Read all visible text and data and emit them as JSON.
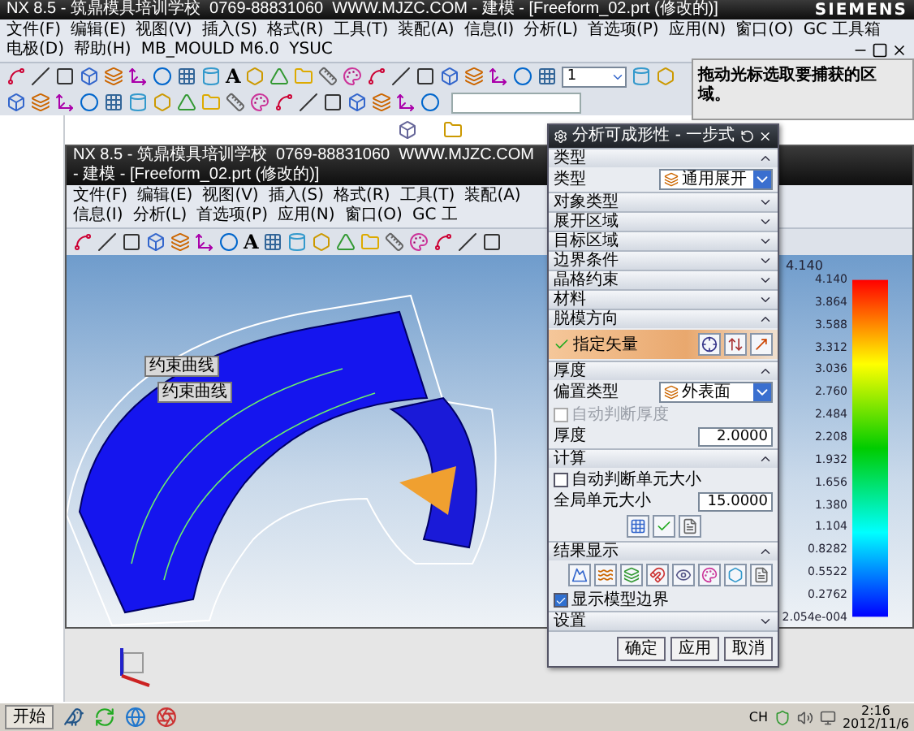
{
  "window": {
    "title": "NX 8.5 - 筑鼎模具培训学校  0769-88831060  WWW.MJZC.COM - 建模 - [Freeform_02.prt (修改的)]",
    "brand": "SIEMENS"
  },
  "menu": [
    "文件(F)",
    "编辑(E)",
    "视图(V)",
    "插入(S)",
    "格式(R)",
    "工具(T)",
    "装配(A)",
    "信息(I)",
    "分析(L)",
    "首选项(P)",
    "应用(N)",
    "窗口(O)",
    "GC 工具箱",
    "电极(D)",
    "帮助(H)",
    "MB_MOULD M6.0",
    "YSUC"
  ],
  "toolbar": {
    "text_tool": "A",
    "layer": "1"
  },
  "tooltip": "拖动光标选取要捕获的区域。",
  "inner_window": {
    "title": "NX 8.5 - 筑鼎模具培训学校  0769-88831060  WWW.MJZC.COM - 建模 - [Freeform_02.prt (修改的)]",
    "menu": [
      "文件(F)",
      "编辑(E)",
      "视图(V)",
      "插入(S)",
      "格式(R)",
      "工具(T)",
      "装配(A)",
      "信息(I)",
      "分析(L)",
      "首选项(P)",
      "应用(N)",
      "窗口(O)",
      "GC 工"
    ],
    "text_tool": "A"
  },
  "callouts": [
    "约束曲线",
    "约束曲线"
  ],
  "legend": {
    "title": "4.140",
    "values": [
      "4.140",
      "3.864",
      "3.588",
      "3.312",
      "3.036",
      "2.760",
      "2.484",
      "2.208",
      "1.932",
      "1.656",
      "1.380",
      "1.104",
      "0.8282",
      "0.5522",
      "0.2762",
      "2.054e-004"
    ]
  },
  "dialog": {
    "title": "分析可成形性 - 一步式",
    "sections": [
      {
        "label": "类型",
        "expanded": true,
        "rows": [
          {
            "kind": "select",
            "label": "类型",
            "value": "通用展开"
          }
        ]
      },
      {
        "label": "对象类型",
        "expanded": false
      },
      {
        "label": "展开区域",
        "expanded": false
      },
      {
        "label": "目标区域",
        "expanded": false
      },
      {
        "label": "边界条件",
        "expanded": false
      },
      {
        "label": "晶格约束",
        "expanded": false
      },
      {
        "label": "材料",
        "expanded": false
      },
      {
        "label": "脱模方向",
        "expanded": true,
        "rows": [
          {
            "kind": "vector",
            "label": "指定矢量"
          }
        ]
      },
      {
        "label": "厚度",
        "expanded": true,
        "rows": [
          {
            "kind": "select",
            "label": "偏置类型",
            "value": "外表面"
          },
          {
            "kind": "checkbox",
            "label": "自动判断厚度",
            "checked": false,
            "disabled": true
          },
          {
            "kind": "number",
            "label": "厚度",
            "value": "2.0000"
          }
        ]
      },
      {
        "label": "计算",
        "expanded": true,
        "rows": [
          {
            "kind": "checkbox",
            "label": "自动判断单元大小",
            "checked": false,
            "disabled": false
          },
          {
            "kind": "number",
            "label": "全局单元大小",
            "value": "15.0000"
          },
          {
            "kind": "compute_icons"
          }
        ]
      },
      {
        "label": "结果显示",
        "expanded": true,
        "rows": [
          {
            "kind": "result_icons"
          },
          {
            "kind": "checkbox",
            "label": "显示模型边界",
            "checked": true,
            "disabled": false
          }
        ]
      },
      {
        "label": "设置",
        "expanded": false
      }
    ],
    "buttons": [
      "确定",
      "应用",
      "取消"
    ]
  },
  "taskbar": {
    "start": "开始",
    "language": "CH",
    "time": "2:16",
    "date": "2012/11/6"
  }
}
